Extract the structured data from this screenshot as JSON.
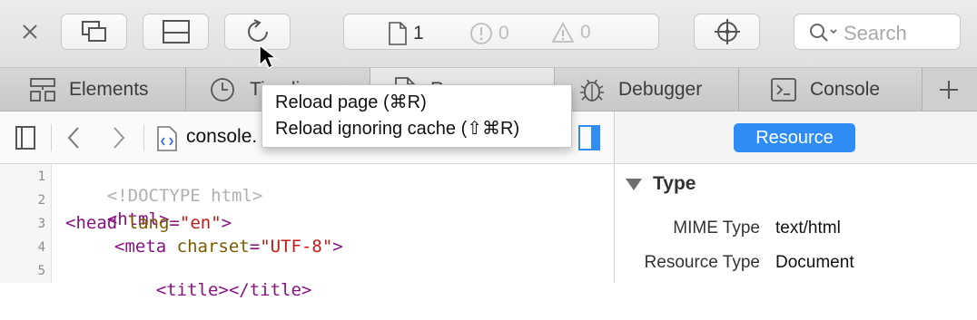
{
  "toolbar": {
    "close_icon": "close-icon",
    "buttons": [
      "undock-icon",
      "split-layout-icon",
      "reload-icon"
    ],
    "status": {
      "resources": "1",
      "errors": "0",
      "warnings": "0"
    },
    "inspect_icon": "crosshair-icon",
    "search_placeholder": "Search"
  },
  "tabs": [
    {
      "label": "Elements",
      "icon": "elements-icon"
    },
    {
      "label": "Timeline",
      "visible_label": "Timeli",
      "icon": "clock-icon"
    },
    {
      "label": "Resources",
      "visible_label": "R",
      "icon": "document-icon"
    },
    {
      "label": "Debugger",
      "icon": "bug-icon"
    },
    {
      "label": "Console",
      "icon": "console-icon"
    }
  ],
  "navbar": {
    "file_name": "console."
  },
  "reload_menu": {
    "items": [
      "Reload page (⌘R)",
      "Reload ignoring cache (⇧⌘R)"
    ]
  },
  "sidebar": {
    "tab_label": "Resource",
    "section_title": "Type",
    "rows": [
      {
        "key": "MIME Type",
        "value": "text/html"
      },
      {
        "key": "Resource Type",
        "value": "Document"
      }
    ]
  },
  "code": {
    "line_numbers": [
      "1",
      "2",
      "3",
      "4",
      "5"
    ],
    "lines": [
      "<!DOCTYPE html>",
      "<html>",
      "<head lang=\"en\">",
      "<meta charset=\"UTF-8\">",
      "<title></title>"
    ]
  },
  "colors": {
    "accent": "#2f8df5",
    "tag": "#881280",
    "attr_value": "#c41a16"
  }
}
